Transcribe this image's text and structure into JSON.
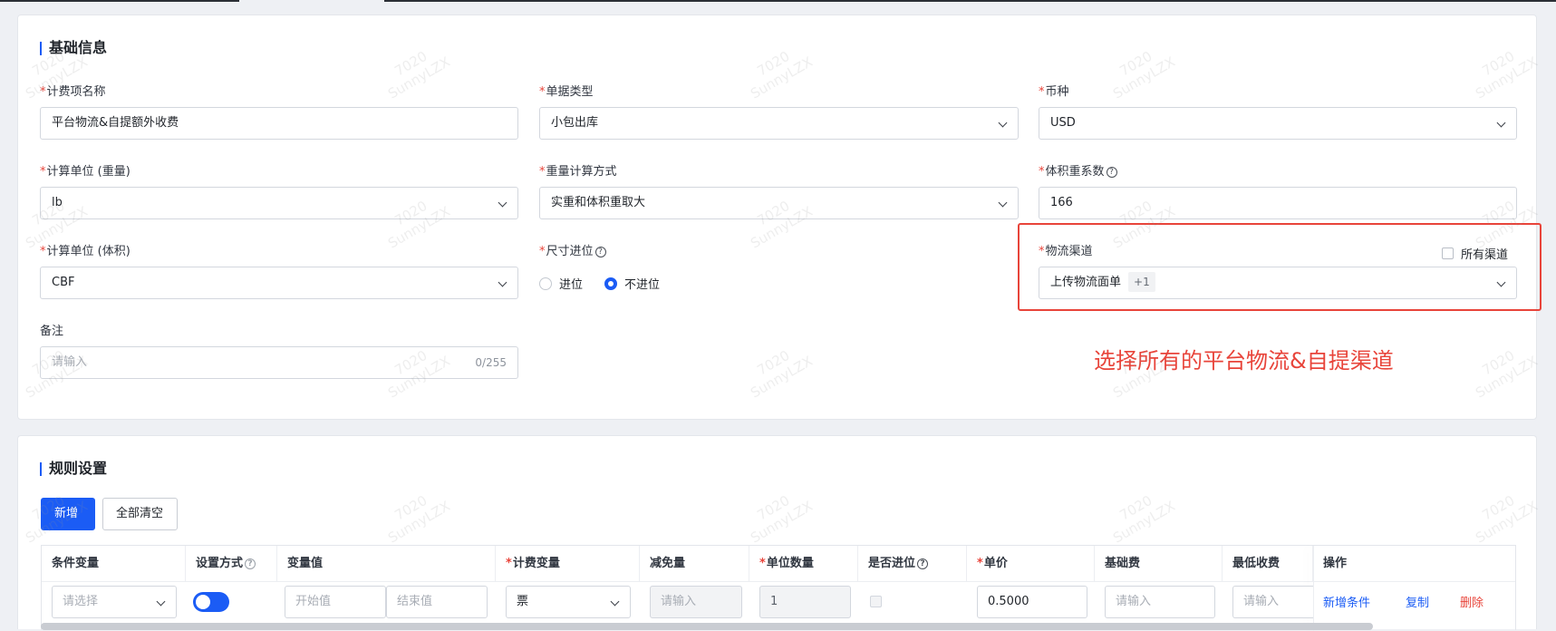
{
  "basic": {
    "title": "基础信息",
    "fee_name": {
      "label": "计费项名称",
      "value": "平台物流&自提额外收费"
    },
    "doc_type": {
      "label": "单据类型",
      "value": "小包出库"
    },
    "currency": {
      "label": "币种",
      "value": "USD"
    },
    "weight_unit": {
      "label": "计算单位 (重量)",
      "value": "lb"
    },
    "weight_method": {
      "label": "重量计算方式",
      "value": "实重和体积重取大"
    },
    "vol_factor": {
      "label": "体积重系数",
      "value": "166"
    },
    "volume_unit": {
      "label": "计算单位 (体积)",
      "value": "CBF"
    },
    "size_round": {
      "label": "尺寸进位",
      "options": [
        "进位",
        "不进位"
      ],
      "selected": "不进位"
    },
    "channel": {
      "label": "物流渠道",
      "all_label": "所有渠道",
      "value": "上传物流面单",
      "extra": "+1"
    },
    "remark": {
      "label": "备注",
      "placeholder": "请输入",
      "counter": "0/255"
    },
    "question_icon": "?"
  },
  "annotation": "选择所有的平台物流&自提渠道",
  "rules": {
    "title": "规则设置",
    "add_button": "新增",
    "clear_button": "全部清空",
    "headers": {
      "cond_var": "条件变量",
      "set_mode": "设置方式",
      "var_value": "变量值",
      "fee_var": "计费变量",
      "exempt": "减免量",
      "unit_qty": "单位数量",
      "rounding": "是否进位",
      "unit_price": "单价",
      "base_fee": "基础费",
      "min_fee": "最低收费",
      "ops": "操作"
    },
    "row": {
      "cond_var_placeholder": "请选择",
      "start_placeholder": "开始值",
      "end_placeholder": "结束值",
      "fee_var_value": "票",
      "exempt_placeholder": "请输入",
      "unit_qty_value": "1",
      "unit_price_value": "0.5000",
      "base_fee_placeholder": "请输入",
      "min_fee_placeholder": "请输入",
      "ops": {
        "add_condition": "新增条件",
        "copy": "复制",
        "delete": "删除"
      }
    }
  },
  "watermark": {
    "line1": "7020",
    "line2": "SunnyLZX"
  },
  "colors": {
    "primary": "#1b5cf5",
    "required": "#e8443a",
    "annotation": "#e8443a",
    "delete": "#e8443a"
  }
}
